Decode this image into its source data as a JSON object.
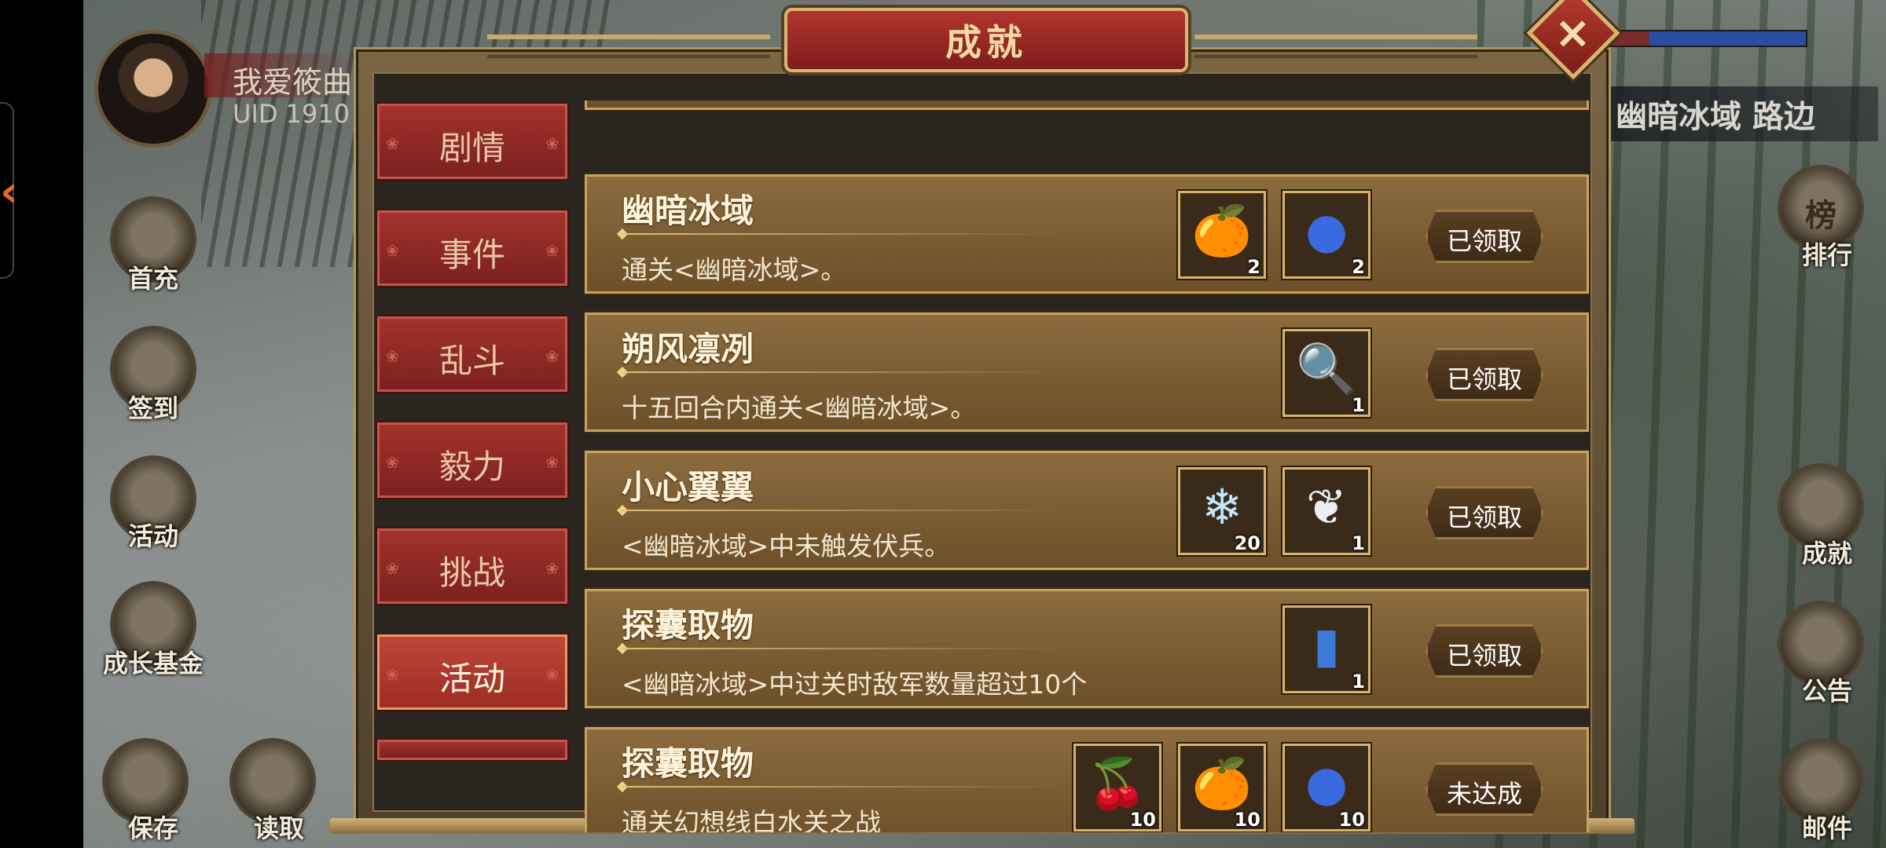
{
  "player": {
    "name": "我爱筱曲",
    "uid": "UID  1910"
  },
  "location": "幽暗冰域 路边",
  "left_menu": [
    "首充",
    "签到",
    "活动",
    "成长基金",
    "保存",
    "读取"
  ],
  "right_menu": [
    "排行",
    "成就",
    "公告",
    "邮件"
  ],
  "ranking_icon_text": "榜",
  "modal": {
    "title": "成就",
    "close_icon": "close-x-icon",
    "categories": [
      {
        "label": "剧情",
        "active": false
      },
      {
        "label": "事件",
        "active": false
      },
      {
        "label": "乱斗",
        "active": false
      },
      {
        "label": "毅力",
        "active": false
      },
      {
        "label": "挑战",
        "active": false
      },
      {
        "label": "活动",
        "active": true
      }
    ],
    "achievements": [
      {
        "title": "幽暗冰域",
        "desc": "通关<幽暗冰域>。",
        "rewards": [
          {
            "icon": "orange-fruit-icon",
            "count": "2"
          },
          {
            "icon": "blue-fruit-icon",
            "count": "2"
          }
        ],
        "status": "已领取"
      },
      {
        "title": "朔风凛冽",
        "desc": "十五回合内通关<幽暗冰域>。",
        "rewards": [
          {
            "icon": "magnifier-icon",
            "count": "1"
          }
        ],
        "status": "已领取"
      },
      {
        "title": "小心翼翼",
        "desc": "<幽暗冰域>中未触发伏兵。",
        "rewards": [
          {
            "icon": "ice-crystal-icon",
            "count": "20"
          },
          {
            "icon": "feather-icon",
            "count": "1"
          }
        ],
        "status": "已领取"
      },
      {
        "title": "探囊取物",
        "desc": "<幽暗冰域>中过关时敌军数量超过10个",
        "rewards": [
          {
            "icon": "scroll-icon",
            "count": "1"
          }
        ],
        "status": "已领取"
      },
      {
        "title": "探囊取物",
        "desc": "通关幻想线白水关之战",
        "rewards": [
          {
            "icon": "red-fruit-icon",
            "count": "10"
          },
          {
            "icon": "orange-fruit-icon",
            "count": "10"
          },
          {
            "icon": "blue-fruit-icon",
            "count": "10"
          }
        ],
        "status": "未达成"
      }
    ]
  }
}
